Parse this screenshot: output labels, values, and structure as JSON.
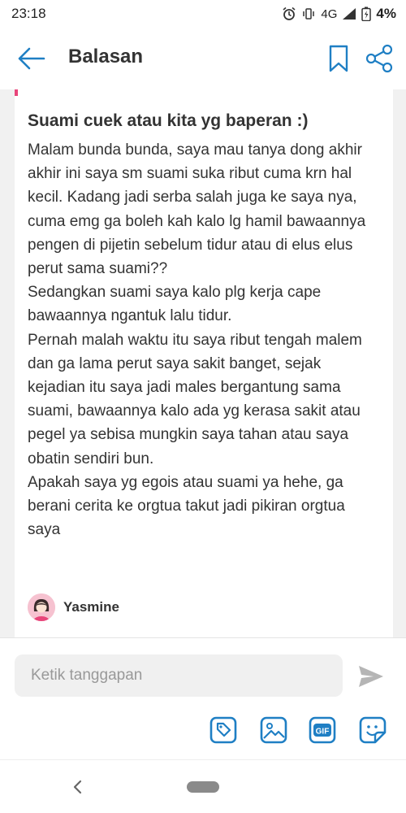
{
  "status_bar": {
    "time": "23:18",
    "network": "4G",
    "battery": "4%"
  },
  "app_bar": {
    "title": "Balasan"
  },
  "post": {
    "title": "Suami cuek atau kita yg baperan :)",
    "paragraphs": [
      "Malam bunda bunda, saya mau tanya dong akhir akhir ini saya sm suami suka ribut cuma krn hal kecil. Kadang jadi serba salah juga ke saya nya, cuma emg ga boleh kah kalo lg hamil bawaannya pengen di pijetin sebelum tidur atau di elus elus perut sama suami??",
      "Sedangkan suami saya kalo plg kerja cape bawaannya ngantuk lalu tidur.",
      "Pernah malah waktu itu saya ribut tengah malem dan ga lama perut saya sakit banget, sejak kejadian itu saya jadi males bergantung sama suami, bawaannya kalo ada yg kerasa sakit atau pegel ya sebisa mungkin saya tahan atau saya obatin sendiri bun.",
      "Apakah saya yg egois atau suami ya hehe, ga berani cerita ke orgtua takut jadi pikiran orgtua saya"
    ],
    "author": "Yasmine"
  },
  "reply": {
    "placeholder": "Ketik tanggapan",
    "tools": [
      "tag-icon",
      "image-icon",
      "gif-icon",
      "sticker-icon"
    ]
  },
  "colors": {
    "accent": "#1f7fc4",
    "marker": "#e8457a",
    "background": "#f1f1f1"
  }
}
